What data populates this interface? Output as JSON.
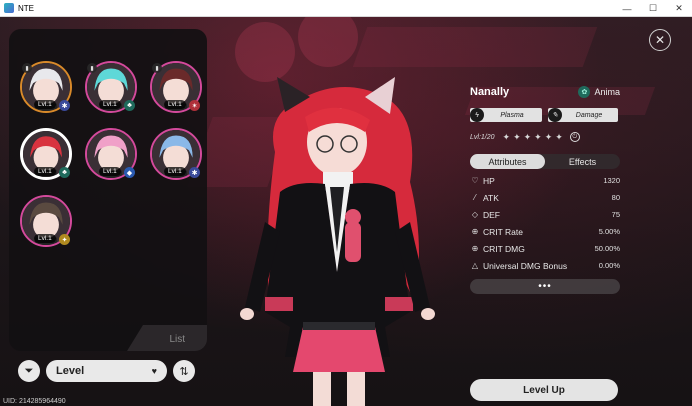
{
  "window": {
    "title": "NTE",
    "minimize": "—",
    "maximize": "☐",
    "close": "✕"
  },
  "roster": {
    "list_label": "List",
    "characters": [
      {
        "level": "Lvl.1",
        "pinned": true,
        "element_icon": "gear-icon",
        "element_glyph": "✱",
        "element_color": "#3a4a9a",
        "hair": "#e8e8ec",
        "ring": "#d98a2a",
        "selected": false
      },
      {
        "level": "Lvl.1",
        "pinned": true,
        "element_icon": "leaf-icon",
        "element_glyph": "♣",
        "element_color": "#1f6a5c",
        "hair": "#5ed8d8",
        "ring": "#d44a9c",
        "selected": false
      },
      {
        "level": "Lvl.1",
        "pinned": true,
        "element_icon": "flame-icon",
        "element_glyph": "✶",
        "element_color": "#b0303a",
        "hair": "#6a2a2a",
        "ring": "#d44a9c",
        "selected": false
      },
      {
        "level": "Lvl.1",
        "pinned": false,
        "element_icon": "leaf-icon",
        "element_glyph": "♣",
        "element_color": "#1f6a5c",
        "hair": "#d8333f",
        "ring": "#ffffff",
        "selected": true
      },
      {
        "level": "Lvl.1",
        "pinned": false,
        "element_icon": "diamond-icon",
        "element_glyph": "◆",
        "element_color": "#2a5ab0",
        "hair": "#f0a0c8",
        "ring": "#d44a9c",
        "selected": false
      },
      {
        "level": "Lvl.1",
        "pinned": false,
        "element_icon": "gear-icon",
        "element_glyph": "✱",
        "element_color": "#3a4a9a",
        "hair": "#8ab8e8",
        "ring": "#d44a9c",
        "selected": false
      },
      {
        "level": "Lvl.1",
        "pinned": false,
        "element_icon": "sparkle-icon",
        "element_glyph": "✦",
        "element_color": "#b08a20",
        "hair": "#5a4a40",
        "ring": "#d44a9c",
        "selected": false
      }
    ]
  },
  "controls": {
    "filter_glyph": "⏷",
    "sort_label": "Level",
    "sort_arrow": "♥",
    "order_glyph": "⇅"
  },
  "uid": "UID: 214285964490",
  "close_glyph": "✕",
  "character": {
    "name": "Nanally",
    "class": "Anima",
    "class_glyph": "✿",
    "tags": [
      {
        "icon": "plasma-icon",
        "glyph": "ϟ",
        "label": "Plasma"
      },
      {
        "icon": "brush-icon",
        "glyph": "✎",
        "label": "Damage"
      }
    ],
    "level_text": "Lvl:1/20",
    "stars": "✦✦✦✦✦✦",
    "power_glyph": "⏻"
  },
  "tabs": [
    {
      "label": "Attributes",
      "active": true
    },
    {
      "label": "Effects",
      "active": false
    }
  ],
  "stats": [
    {
      "icon": "heart-icon",
      "glyph": "♡",
      "label": "HP",
      "value": "1320"
    },
    {
      "icon": "sword-icon",
      "glyph": "⁄",
      "label": "ATK",
      "value": "80"
    },
    {
      "icon": "shield-icon",
      "glyph": "◇",
      "label": "DEF",
      "value": "75"
    },
    {
      "icon": "crit-rate-icon",
      "glyph": "⊕",
      "label": "CRIT Rate",
      "value": "5.00%"
    },
    {
      "icon": "crit-dmg-icon",
      "glyph": "⊕",
      "label": "CRIT DMG",
      "value": "50.00%"
    },
    {
      "icon": "triangle-icon",
      "glyph": "△",
      "label": "Universal DMG Bonus",
      "value": "0.00%"
    }
  ],
  "more_label": "•••",
  "level_up_label": "Level Up",
  "colors": {
    "accent_pink": "#d44a9c",
    "panel_bg": "#121012",
    "button_bg": "#e4e4e4"
  }
}
